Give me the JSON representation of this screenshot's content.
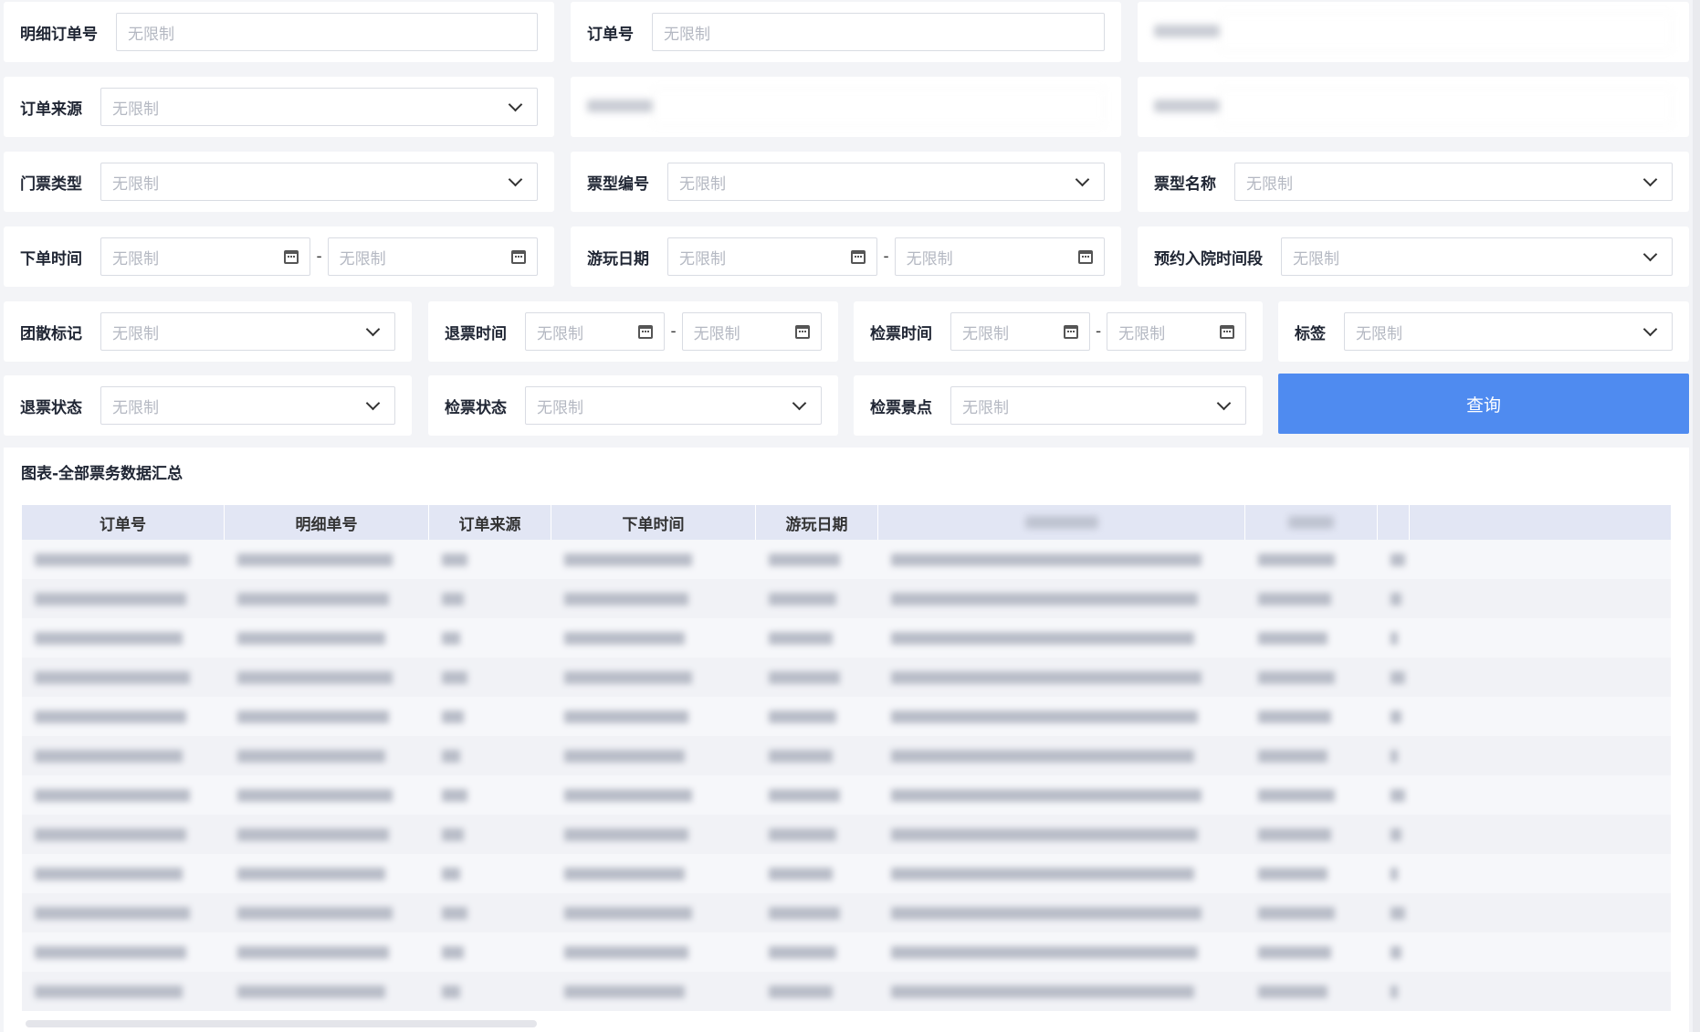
{
  "filters": [
    {
      "label": "明细订单号",
      "type": "text",
      "placeholder": "无限制"
    },
    {
      "label": "订单号",
      "type": "text",
      "placeholder": "无限制"
    },
    {
      "label": "",
      "type": "blurred",
      "placeholder": ""
    },
    {
      "label": "订单来源",
      "type": "select",
      "placeholder": "无限制"
    },
    {
      "label": "",
      "type": "blurred",
      "placeholder": ""
    },
    {
      "label": "",
      "type": "blurred",
      "placeholder": ""
    },
    {
      "label": "门票类型",
      "type": "select",
      "placeholder": "无限制"
    },
    {
      "label": "票型编号",
      "type": "select",
      "placeholder": "无限制"
    },
    {
      "label": "票型名称",
      "type": "select",
      "placeholder": "无限制"
    },
    {
      "label": "下单时间",
      "type": "range",
      "placeholder": "无限制"
    },
    {
      "label": "游玩日期",
      "type": "range",
      "placeholder": "无限制"
    },
    {
      "label": "预约入院时间段",
      "type": "select",
      "placeholder": "无限制"
    },
    {
      "label": "团散标记",
      "type": "select",
      "placeholder": "无限制"
    },
    {
      "label": "退票时间",
      "type": "range",
      "placeholder": "无限制"
    },
    {
      "label": "检票时间",
      "type": "range",
      "placeholder": "无限制"
    },
    {
      "label": "标签",
      "type": "select",
      "placeholder": "无限制"
    },
    {
      "label": "退票状态",
      "type": "select",
      "placeholder": "无限制"
    },
    {
      "label": "检票状态",
      "type": "select",
      "placeholder": "无限制"
    },
    {
      "label": "检票景点",
      "type": "select",
      "placeholder": "无限制"
    }
  ],
  "range_separator": "-",
  "query_button": "查询",
  "table": {
    "title": "图表-全部票务数据汇总",
    "columns": [
      "订单号",
      "明细单号",
      "订单来源",
      "下单时间",
      "游玩日期",
      "",
      "",
      ""
    ],
    "row_count": 12
  }
}
